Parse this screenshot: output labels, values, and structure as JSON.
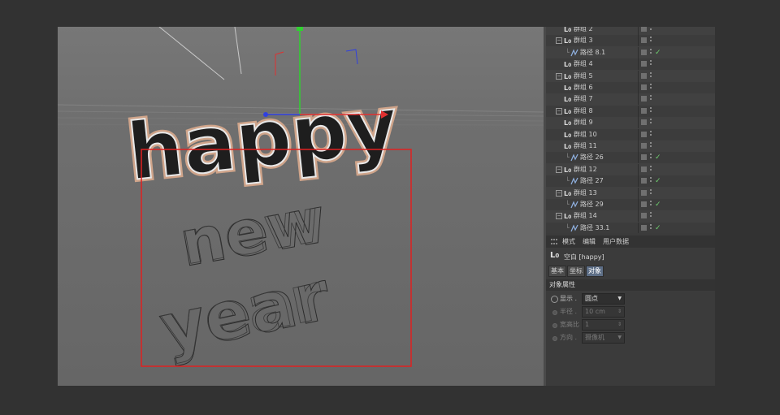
{
  "viewport": {
    "scene_text_top": "happy",
    "scene_text_mid": "new",
    "scene_text_bottom": "year"
  },
  "object_tree": {
    "rows": [
      {
        "name": "群组 2",
        "type": "null",
        "expandable": false,
        "check": false
      },
      {
        "name": "群组 3",
        "type": "null",
        "expandable": true,
        "check": false
      },
      {
        "name": "路径 8.1",
        "type": "spline",
        "expandable": false,
        "check": true
      },
      {
        "name": "群组 4",
        "type": "null",
        "expandable": false,
        "check": false
      },
      {
        "name": "群组 5",
        "type": "null",
        "expandable": true,
        "check": false
      },
      {
        "name": "群组 6",
        "type": "null",
        "expandable": false,
        "check": false
      },
      {
        "name": "群组 7",
        "type": "null",
        "expandable": false,
        "check": false
      },
      {
        "name": "群组 8",
        "type": "null",
        "expandable": true,
        "check": false
      },
      {
        "name": "群组 9",
        "type": "null",
        "expandable": false,
        "check": false
      },
      {
        "name": "群组 10",
        "type": "null",
        "expandable": false,
        "check": false
      },
      {
        "name": "群组 11",
        "type": "null",
        "expandable": false,
        "check": false
      },
      {
        "name": "路径 26",
        "type": "spline",
        "expandable": false,
        "check": true
      },
      {
        "name": "群组 12",
        "type": "null",
        "expandable": true,
        "check": false
      },
      {
        "name": "路径 27",
        "type": "spline",
        "expandable": false,
        "check": true
      },
      {
        "name": "群组 13",
        "type": "null",
        "expandable": true,
        "check": false
      },
      {
        "name": "路径 29",
        "type": "spline",
        "expandable": false,
        "check": true
      },
      {
        "name": "群组 14",
        "type": "null",
        "expandable": true,
        "check": false
      },
      {
        "name": "路径 33.1",
        "type": "spline",
        "expandable": false,
        "check": true
      }
    ]
  },
  "attributes": {
    "tabs": [
      "模式",
      "编辑",
      "用户数据"
    ],
    "object_label": "空白 [happy]",
    "subtabs": [
      "基本",
      "坐标",
      "对象"
    ],
    "active_subtab": "对象",
    "section_title": "对象属性",
    "props": [
      {
        "label": "显示 .",
        "value": "圆点",
        "enabled": true
      },
      {
        "label": "半径 .",
        "value": "10 cm",
        "enabled": false
      },
      {
        "label": "宽高比",
        "value": "1",
        "enabled": false
      },
      {
        "label": "方向 .",
        "value": "摄像机",
        "enabled": false
      }
    ]
  },
  "colors": {
    "selection_rect": "#e02020",
    "axis_x": "#e03030",
    "axis_y": "#30d030",
    "axis_z": "#3040e0",
    "check": "#6fd06f",
    "active_tab": "#5d6e86"
  }
}
